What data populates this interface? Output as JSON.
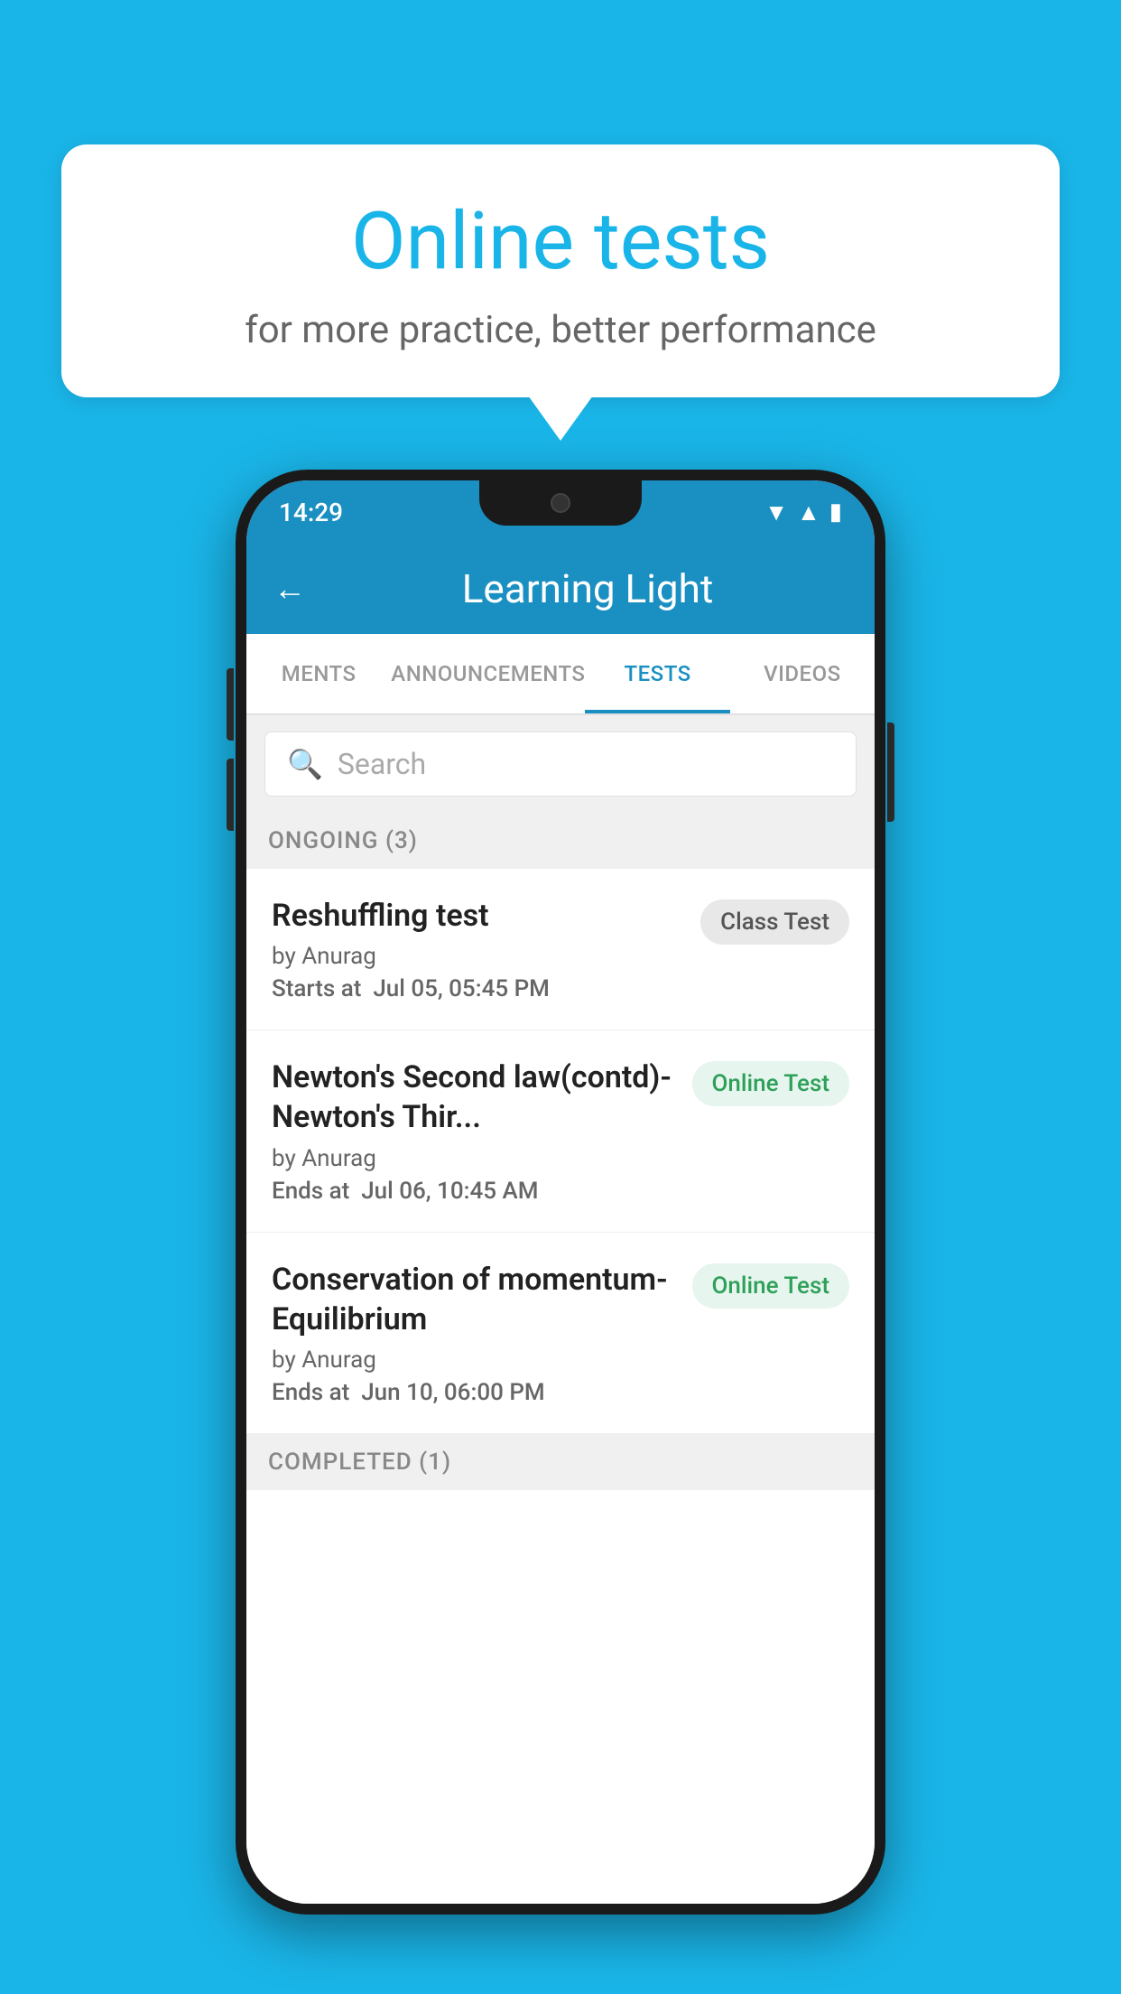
{
  "background_color": "#1ab5e8",
  "bubble": {
    "title": "Online tests",
    "subtitle": "for more practice, better performance"
  },
  "phone": {
    "status_bar": {
      "time": "14:29",
      "icons": [
        "wifi",
        "signal",
        "battery"
      ]
    },
    "app_bar": {
      "title": "Learning Light",
      "back_label": "←"
    },
    "tabs": [
      {
        "label": "MENTS",
        "active": false
      },
      {
        "label": "ANNOUNCEMENTS",
        "active": false
      },
      {
        "label": "TESTS",
        "active": true
      },
      {
        "label": "VIDEOS",
        "active": false
      }
    ],
    "search": {
      "placeholder": "Search"
    },
    "sections": [
      {
        "label": "ONGOING (3)",
        "tests": [
          {
            "title": "Reshuffling test",
            "author": "by Anurag",
            "date_label": "Starts at",
            "date": "Jul 05, 05:45 PM",
            "badge": "Class Test",
            "badge_type": "class"
          },
          {
            "title": "Newton's Second law(contd)-Newton's Thir...",
            "author": "by Anurag",
            "date_label": "Ends at",
            "date": "Jul 06, 10:45 AM",
            "badge": "Online Test",
            "badge_type": "online"
          },
          {
            "title": "Conservation of momentum-Equilibrium",
            "author": "by Anurag",
            "date_label": "Ends at",
            "date": "Jun 10, 06:00 PM",
            "badge": "Online Test",
            "badge_type": "online"
          }
        ]
      },
      {
        "label": "COMPLETED (1)",
        "tests": []
      }
    ]
  }
}
